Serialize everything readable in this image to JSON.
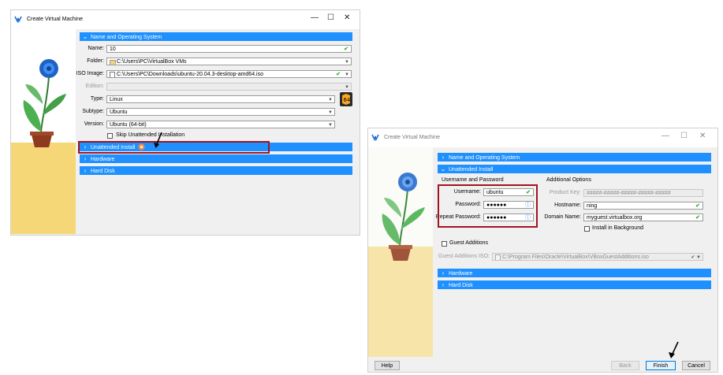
{
  "left_window": {
    "title": "Create Virtual Machine",
    "controls": {
      "minimize": "—",
      "maximize": "☐",
      "close": "✕"
    },
    "sections": {
      "name_os": "Name and Operating System",
      "unattended": "Unattended Install",
      "hardware": "Hardware",
      "hard_disk": "Hard Disk"
    },
    "form": {
      "name_label": "Name:",
      "name_value": "10",
      "folder_label": "Folder:",
      "folder_value": "C:\\Users\\PC\\VirtualBox VMs",
      "iso_label": "ISO Image:",
      "iso_value": "C:\\Users\\PC\\Downloads\\ubuntu-20.04.3-desktop-amd64.iso",
      "edition_label": "Edition:",
      "type_label": "Type:",
      "type_value": "Linux",
      "subtype_label": "Subtype:",
      "subtype_value": "Ubuntu",
      "version_label": "Version:",
      "version_value": "Ubuntu (64-bit)",
      "skip_label": "Skip Unattended Installation"
    }
  },
  "right_window": {
    "title": "Create Virtual Machine",
    "controls": {
      "minimize": "—",
      "maximize": "☐",
      "close": "✕"
    },
    "sections": {
      "name_os": "Name and Operating System",
      "unattended": "Unattended Install",
      "hardware": "Hardware",
      "hard_disk": "Hard Disk"
    },
    "user_group": {
      "heading": "Username and Password",
      "username_label": "Username:",
      "username_value": "ubuntu",
      "password_label": "Password:",
      "password_value": "●●●●●●",
      "repeat_label": "Repeat Password:",
      "repeat_value": "●●●●●●"
    },
    "options": {
      "heading": "Additional Options",
      "product_key_label": "Product Key:",
      "product_key_placeholder": "#####-#####-#####-#####-#####",
      "hostname_label": "Hostname:",
      "hostname_value": "ning",
      "domain_label": "Domain Name:",
      "domain_value": "myguest.virtualbox.org",
      "background_label": "Install in Background"
    },
    "guest": {
      "label": "Guest Additions",
      "iso_label": "Guest Additions ISO:",
      "iso_value": "C:\\Program Files\\Oracle\\VirtualBox\\VBoxGuestAdditions.iso"
    },
    "buttons": {
      "help": "Help",
      "back": "Back",
      "finish": "Finish",
      "cancel": "Cancel"
    }
  },
  "colors": {
    "section": "#1e90ff",
    "highlight": "#a0141e",
    "ok": "#2fb52f",
    "sand": "#f6d778"
  },
  "icons": [
    "app-icon",
    "folder-icon",
    "iso-disc-icon",
    "check-icon",
    "chevron-right-icon",
    "chevron-down-icon",
    "info-icon",
    "os-icon",
    "arrow-pointer"
  ]
}
